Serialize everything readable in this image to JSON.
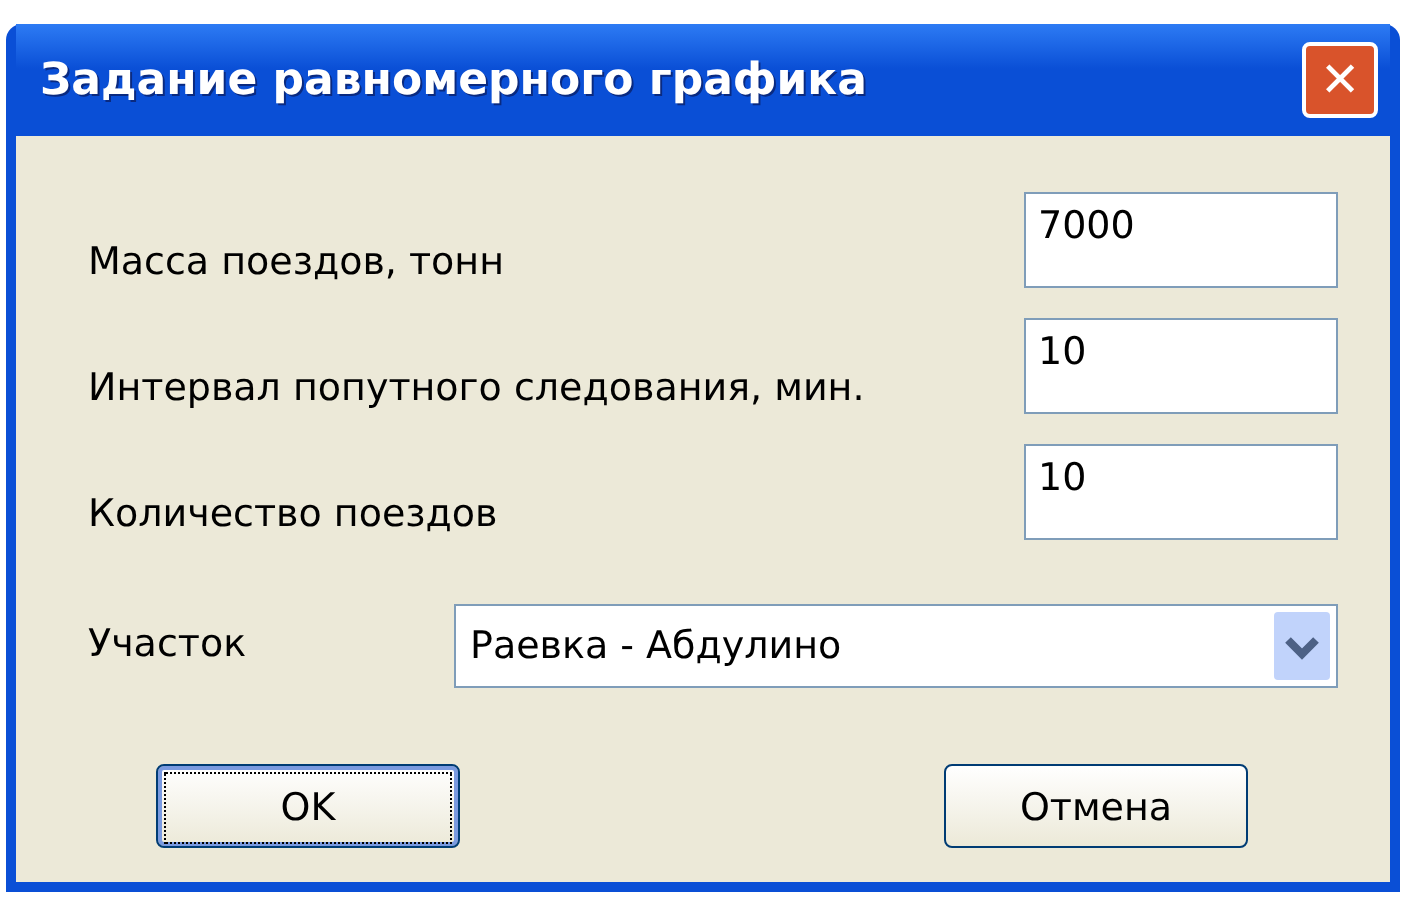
{
  "window": {
    "title": "Задание равномерного графика",
    "close_icon": "✕"
  },
  "fields": [
    {
      "label": "Масса поездов, тонн",
      "value": "7000"
    },
    {
      "label": "Интервал попутного следования, мин.",
      "value": "10"
    },
    {
      "label": "Количество поездов",
      "value": "10"
    }
  ],
  "section": {
    "label": "Участок",
    "value": "Раевка - Абдулино"
  },
  "buttons": [
    {
      "label": "OK",
      "focused": true
    },
    {
      "label": "Отмена",
      "focused": false
    }
  ]
}
